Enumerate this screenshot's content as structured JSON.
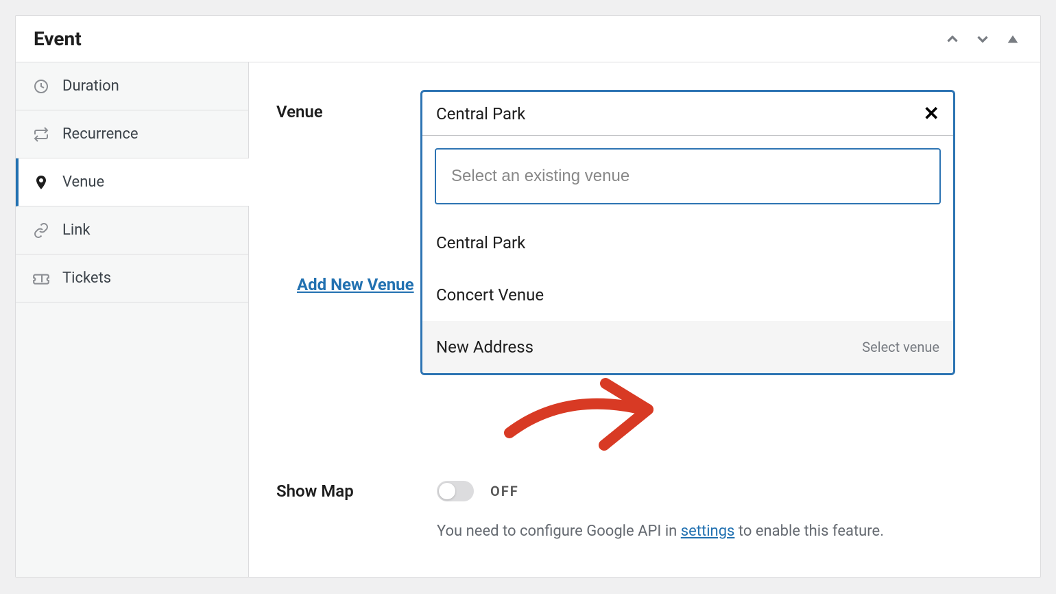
{
  "panel": {
    "title": "Event"
  },
  "sidebar": {
    "items": [
      {
        "label": "Duration",
        "icon": "clock-icon"
      },
      {
        "label": "Recurrence",
        "icon": "repeat-icon"
      },
      {
        "label": "Venue",
        "icon": "pin-icon",
        "active": true
      },
      {
        "label": "Link",
        "icon": "link-icon"
      },
      {
        "label": "Tickets",
        "icon": "ticket-icon"
      }
    ]
  },
  "venue": {
    "label": "Venue",
    "selected": "Central Park",
    "search_placeholder": "Select an existing venue",
    "options": [
      {
        "label": "Central Park"
      },
      {
        "label": "Concert Venue"
      },
      {
        "label": "New Address",
        "hint": "Select venue",
        "highlighted": true
      }
    ],
    "add_new_label": "Add New Venue"
  },
  "showmap": {
    "label": "Show Map",
    "state": "OFF",
    "help_pre": "You need to configure Google API in ",
    "help_link": "settings",
    "help_post": " to enable this feature."
  }
}
